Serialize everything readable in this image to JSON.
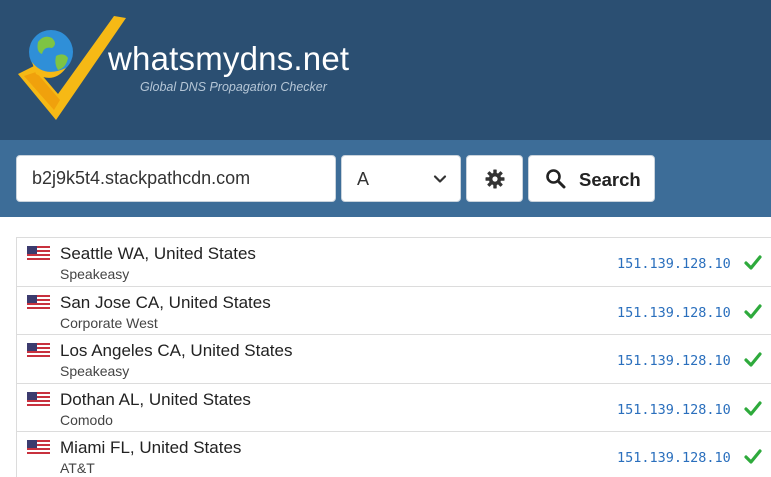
{
  "header": {
    "brand": "whatsmydns.net",
    "tagline": "Global DNS Propagation Checker"
  },
  "search": {
    "domain_value": "b2j9k5t4.stackpathcdn.com",
    "record_type": "A",
    "search_label": "Search"
  },
  "icons": {
    "logo": "globe-check-logo",
    "settings": "gear-icon",
    "search": "magnifier-icon",
    "dropdown": "chevron-down-icon",
    "flag": "us-flag-icon",
    "status": "check-icon"
  },
  "colors": {
    "header_bg": "#2b4f72",
    "searchbar_bg": "#3d6d98",
    "ip_text": "#2a6fbd",
    "check": "#2eaa3c"
  },
  "results": [
    {
      "location": "Seattle WA, United States",
      "provider": "Speakeasy",
      "ip": "151.139.128.10"
    },
    {
      "location": "San Jose CA, United States",
      "provider": "Corporate West",
      "ip": "151.139.128.10"
    },
    {
      "location": "Los Angeles CA, United States",
      "provider": "Speakeasy",
      "ip": "151.139.128.10"
    },
    {
      "location": "Dothan AL, United States",
      "provider": "Comodo",
      "ip": "151.139.128.10"
    },
    {
      "location": "Miami FL, United States",
      "provider": "AT&T",
      "ip": "151.139.128.10"
    }
  ]
}
